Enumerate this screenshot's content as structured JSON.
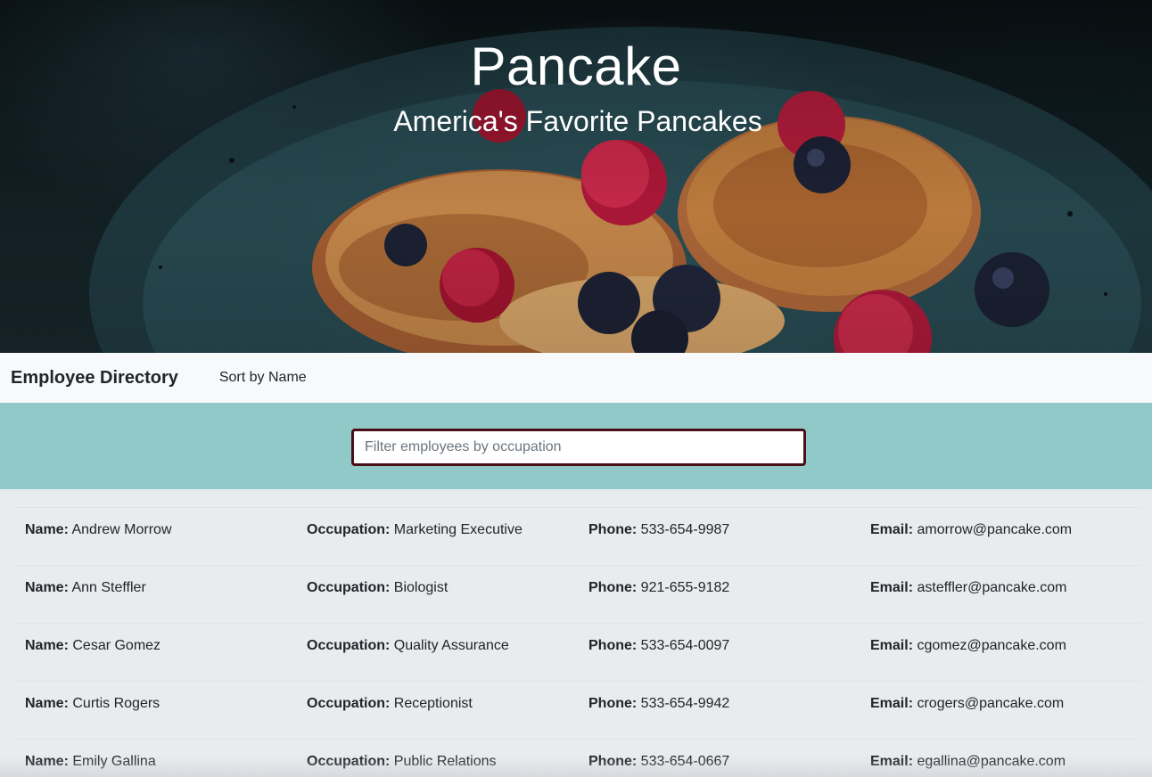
{
  "hero": {
    "title": "Pancake",
    "subtitle": "America's Favorite Pancakes"
  },
  "navbar": {
    "brand": "Employee Directory",
    "sort_label": "Sort by Name"
  },
  "search": {
    "placeholder": "Filter employees by occupation",
    "value": ""
  },
  "labels": {
    "name": "Name:",
    "occupation": "Occupation:",
    "phone": "Phone:",
    "email": "Email:"
  },
  "employees": [
    {
      "name": "Andrew Morrow",
      "occupation": "Marketing Executive",
      "phone": "533-654-9987",
      "email": "amorrow@pancake.com"
    },
    {
      "name": "Ann Steffler",
      "occupation": "Biologist",
      "phone": "921-655-9182",
      "email": "asteffler@pancake.com"
    },
    {
      "name": "Cesar Gomez",
      "occupation": "Quality Assurance",
      "phone": "533-654-0097",
      "email": "cgomez@pancake.com"
    },
    {
      "name": "Curtis Rogers",
      "occupation": "Receptionist",
      "phone": "533-654-9942",
      "email": "crogers@pancake.com"
    },
    {
      "name": "Emily Gallina",
      "occupation": "Public Relations",
      "phone": "533-654-0667",
      "email": "egallina@pancake.com"
    }
  ],
  "colors": {
    "navbar_bg": "#f8f9fa",
    "search_band_bg": "#90c9c7",
    "search_border": "#4a0e16",
    "page_bg": "#e9ecef"
  }
}
